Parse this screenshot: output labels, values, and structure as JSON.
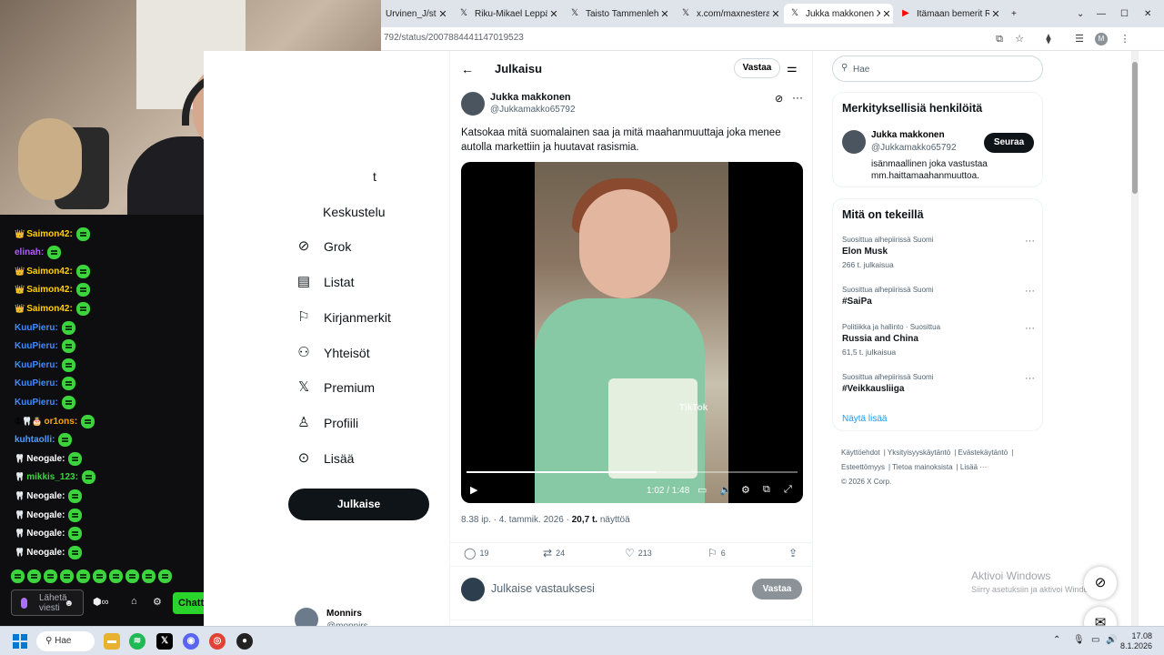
{
  "browser": {
    "tabs": [
      {
        "label": "Urvinen_J/statu",
        "icon": "x-logo-icon"
      },
      {
        "label": "Riku-Mikael Leppäne",
        "icon": "x-logo-icon"
      },
      {
        "label": "Taisto Tammenlehvä",
        "icon": "x-logo-icon"
      },
      {
        "label": "x.com/maxnesterak/",
        "icon": "x-logo-icon"
      },
      {
        "label": "Jukka makkonen X:ss",
        "icon": "x-logo-icon",
        "active": true
      },
      {
        "label": "Itämaan bemerit Rov",
        "icon": "youtube-icon"
      }
    ],
    "url": "792/status/2007884441147019523",
    "profile_initial": "M"
  },
  "chat": {
    "messages": [
      {
        "user": "Saimon42:",
        "color": "#ffd000",
        "badge": "crown"
      },
      {
        "user": "elinah:",
        "color": "#b45cff",
        "badge": ""
      },
      {
        "user": "Saimon42:",
        "color": "#ffd000",
        "badge": "crown"
      },
      {
        "user": "Saimon42:",
        "color": "#ffd000",
        "badge": "crown"
      },
      {
        "user": "Saimon42:",
        "color": "#ffd000",
        "badge": "crown"
      },
      {
        "user": "KuuPieru:",
        "color": "#3f8cff",
        "badge": ""
      },
      {
        "user": "KuuPieru:",
        "color": "#3f8cff",
        "badge": ""
      },
      {
        "user": "KuuPieru:",
        "color": "#3f8cff",
        "badge": ""
      },
      {
        "user": "KuuPieru:",
        "color": "#3f8cff",
        "badge": ""
      },
      {
        "user": "KuuPieru:",
        "color": "#3f8cff",
        "badge": ""
      },
      {
        "user": "or1ons:",
        "color": "#ffa500",
        "badge": "multi"
      },
      {
        "user": "kuhtaolli:",
        "color": "#4f9cff",
        "badge": ""
      },
      {
        "user": "Neogale:",
        "color": "#ffffff",
        "badge": "tooth"
      },
      {
        "user": "mikkis_123:",
        "color": "#3cd43c",
        "badge": "tooth"
      },
      {
        "user": "Neogale:",
        "color": "#ffffff",
        "badge": "tooth"
      },
      {
        "user": "Neogale:",
        "color": "#ffffff",
        "badge": "tooth"
      },
      {
        "user": "Neogale:",
        "color": "#ffffff",
        "badge": "tooth"
      },
      {
        "user": "Neogale:",
        "color": "#ffffff",
        "badge": "tooth"
      }
    ],
    "input_placeholder": "Lähetä viesti",
    "chat_button": "Chatti"
  },
  "nav": {
    "partial_items": [
      "t",
      "Keskustelu"
    ],
    "items": [
      {
        "label": "Grok",
        "icon": "grok-icon"
      },
      {
        "label": "Listat",
        "icon": "list-icon"
      },
      {
        "label": "Kirjanmerkit",
        "icon": "bookmark-icon"
      },
      {
        "label": "Yhteisöt",
        "icon": "communities-icon"
      },
      {
        "label": "Premium",
        "icon": "x-logo-icon"
      },
      {
        "label": "Profiili",
        "icon": "profile-icon"
      },
      {
        "label": "Lisää",
        "icon": "more-circle-icon"
      }
    ],
    "post_button": "Julkaise",
    "account": {
      "name": "Monnirs",
      "handle": "@monnirs"
    }
  },
  "post": {
    "header_title": "Julkaisu",
    "reply_pill": "Vastaa",
    "author": "Jukka makkonen",
    "handle": "@Jukkamakko65792",
    "text": "Katsokaa mitä suomalainen saa ja mitä maahanmuuttaja joka menee autolla markettiin ja huutavat rasismia.",
    "video": {
      "watermark": "TikTok",
      "time": "1:02 / 1:48",
      "progress": 0.574
    },
    "meta_time": "8.38 ip. · 4. tammik. 2026 · ",
    "meta_views": "20,7 t.",
    "meta_views_label": " näyttöä",
    "stats": {
      "replies": "19",
      "reposts": "24",
      "likes": "213",
      "bookmarks": "6"
    },
    "reply_placeholder": "Julkaise vastauksesi",
    "reply_button": "Vastaa"
  },
  "sidebar": {
    "search_placeholder": "Hae",
    "who_title": "Merkityksellisiä henkilöitä",
    "who": {
      "name": "Jukka makkonen",
      "handle": "@Jukkamakko65792",
      "bio": "isänmaallinen joka vastustaa mm.haittamaahanmuuttoa.",
      "follow": "Seuraa"
    },
    "trends_title": "Mitä on tekeillä",
    "trends": [
      {
        "context": "Suosittua alhepiirissä Suomi",
        "name": "Elon Musk",
        "count": "266 t. julkaisua"
      },
      {
        "context": "Suosittua alhepiirissä Suomi",
        "name": "#SaiPa",
        "count": ""
      },
      {
        "context": "Politiikka ja hallinto · Suosittua",
        "name": "Russia and China",
        "count": "61,5 t. julkaisua"
      },
      {
        "context": "Suosittua alhepiirissä Suomi",
        "name": "#Veikkausliiga",
        "count": ""
      }
    ],
    "show_more": "Näytä lisää",
    "footer": [
      "Käyttöehdot",
      "Yksityisyyskäytäntö",
      "Evästekäytäntö",
      "Esteettömyys",
      "Tietoa mainoksista",
      "Lisää ···",
      "© 2026 X Corp."
    ],
    "activate_title": "Aktivoi Windows",
    "activate_sub": "Siirry asetuksiin ja aktivoi Windows."
  },
  "taskbar": {
    "search": "Hae",
    "time": "17.08",
    "date": "8.1.2026"
  }
}
